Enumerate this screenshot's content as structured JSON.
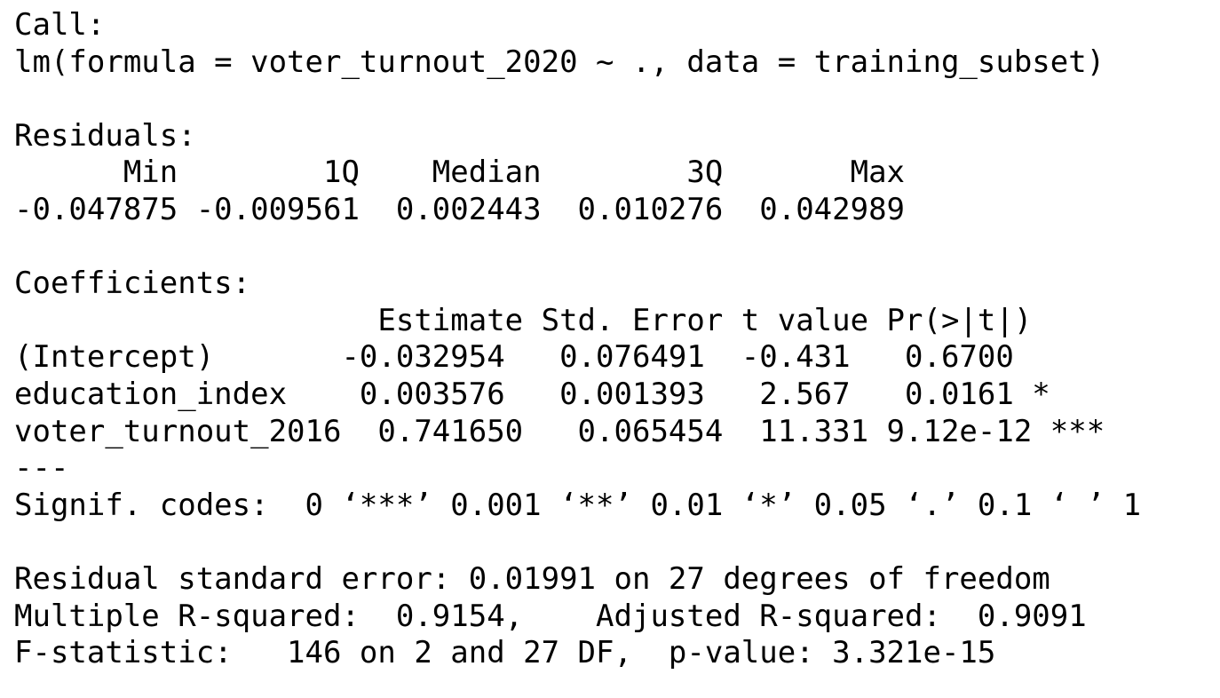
{
  "call": {
    "label": "Call:",
    "formula": "lm(formula = voter_turnout_2020 ~ ., data = training_subset)"
  },
  "residuals": {
    "label": "Residuals:",
    "header": "      Min        1Q    Median        3Q       Max",
    "values": "-0.047875 -0.009561  0.002443  0.010276  0.042989"
  },
  "coefficients": {
    "label": "Coefficients:",
    "header": "                    Estimate Std. Error t value Pr(>|t|)",
    "rows": [
      "(Intercept)       -0.032954   0.076491  -0.431   0.6700",
      "education_index    0.003576   0.001393   2.567   0.0161 *",
      "voter_turnout_2016  0.741650   0.065454  11.331 9.12e-12 ***"
    ]
  },
  "signif": {
    "separator": "---",
    "codes": "Signif. codes:  0 ‘***’ 0.001 ‘**’ 0.01 ‘*’ 0.05 ‘.’ 0.1 ‘ ’ 1"
  },
  "summary": {
    "residual_se": "Residual standard error: 0.01991 on 27 degrees of freedom",
    "r_squared": "Multiple R-squared:  0.9154,    Adjusted R-squared:  0.9091",
    "f_statistic": "F-statistic:   146 on 2 and 27 DF,  p-value: 3.321e-15"
  }
}
